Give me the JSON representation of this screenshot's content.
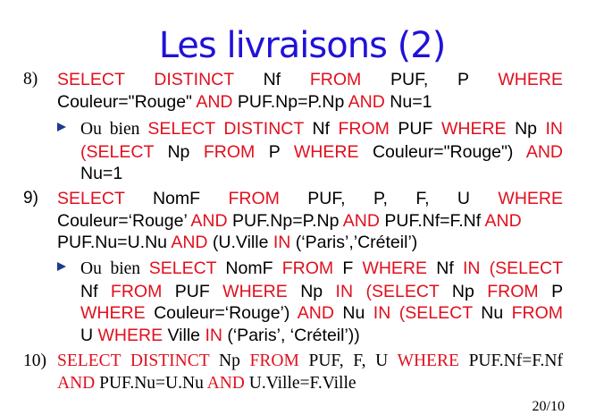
{
  "title": "Les livraisons (2)",
  "q8": {
    "num": "8)",
    "l1": [
      [
        "SELECT",
        "k"
      ],
      [
        "DISTINCT",
        "k"
      ],
      [
        "Nf",
        "t"
      ],
      [
        "FROM",
        "k"
      ],
      [
        "PUF,",
        "t"
      ],
      [
        "P",
        "t"
      ],
      [
        "WHERE",
        "k"
      ]
    ],
    "l2": [
      [
        "Couleur=\"Rouge\" ",
        "t"
      ],
      [
        "AND",
        "k"
      ],
      [
        " PUF.Np=P.Np ",
        "t"
      ],
      [
        "AND",
        "k"
      ],
      [
        " Nu=1",
        "t"
      ]
    ],
    "alt_prefix": "Ou bien ",
    "a1": [
      [
        "SELECT DISTINCT",
        "k"
      ],
      [
        " Nf ",
        "t"
      ],
      [
        "FROM",
        "k"
      ],
      [
        " PUF ",
        "t"
      ],
      [
        "WHERE",
        "k"
      ],
      [
        " Np ",
        "t"
      ],
      [
        "IN",
        "k"
      ]
    ],
    "a2": [
      [
        "(SELECT",
        "k"
      ],
      [
        "Np",
        "t"
      ],
      [
        "FROM",
        "k"
      ],
      [
        "P",
        "t"
      ],
      [
        "WHERE",
        "k"
      ],
      [
        "Couleur=\"Rouge\")",
        "t"
      ],
      [
        "AND",
        "k"
      ]
    ],
    "a3": "Nu=1"
  },
  "q9": {
    "num": "9)",
    "l1": [
      [
        "SELECT",
        "k"
      ],
      [
        "NomF",
        "t"
      ],
      [
        "FROM",
        "k"
      ],
      [
        "PUF,",
        "t"
      ],
      [
        "P,",
        "t"
      ],
      [
        "F,",
        "t"
      ],
      [
        "U",
        "t"
      ],
      [
        "WHERE",
        "k"
      ]
    ],
    "l2": [
      [
        "Couleur=‘Rouge’ ",
        "t"
      ],
      [
        "AND",
        "k"
      ],
      [
        " PUF.Np=P.Np ",
        "t"
      ],
      [
        "AND",
        "k"
      ],
      [
        " PUF.Nf=F.Nf ",
        "t"
      ],
      [
        "AND",
        "k"
      ]
    ],
    "l3": [
      [
        "PUF.Nu=U.Nu ",
        "t"
      ],
      [
        "AND",
        "k"
      ],
      [
        " (U.Ville ",
        "t"
      ],
      [
        "IN",
        "k"
      ],
      [
        " (‘Paris’,’Créteil’)",
        "t"
      ]
    ],
    "alt_prefix": "Ou bien ",
    "a1": [
      [
        "SELECT",
        "k"
      ],
      [
        " NomF ",
        "t"
      ],
      [
        "FROM",
        "k"
      ],
      [
        " F ",
        "t"
      ],
      [
        "WHERE",
        "k"
      ],
      [
        " Nf ",
        "t"
      ],
      [
        "IN",
        "k"
      ],
      [
        " (SELECT",
        "k"
      ]
    ],
    "a2": [
      [
        "Nf",
        "t"
      ],
      [
        "FROM",
        "k"
      ],
      [
        "PUF",
        "t"
      ],
      [
        "WHERE",
        "k"
      ],
      [
        "Np",
        "t"
      ],
      [
        "IN",
        "k"
      ],
      [
        "(SELECT",
        "k"
      ],
      [
        "Np",
        "t"
      ],
      [
        "FROM",
        "k"
      ],
      [
        "P",
        "t"
      ]
    ],
    "a3": [
      [
        "WHERE",
        "k"
      ],
      [
        "Couleur=‘Rouge’)",
        "t"
      ],
      [
        "AND",
        "k"
      ],
      [
        "Nu",
        "t"
      ],
      [
        "IN",
        "k"
      ],
      [
        "(SELECT",
        "k"
      ],
      [
        "Nu",
        "t"
      ],
      [
        "FROM",
        "k"
      ]
    ],
    "a4": [
      [
        "U ",
        "t"
      ],
      [
        "WHERE",
        "k"
      ],
      [
        " Ville ",
        "t"
      ],
      [
        "IN",
        "k"
      ],
      [
        " (‘Paris’, ‘Créteil’))",
        "t"
      ]
    ]
  },
  "q10": {
    "num": "10)",
    "l1": [
      [
        "SELECT DISTINCT",
        "k"
      ],
      [
        " Np ",
        "t"
      ],
      [
        "FROM",
        "k"
      ],
      [
        " PUF, F, U ",
        "t"
      ],
      [
        "WHERE",
        "k"
      ],
      [
        " PUF.Nf=F.Nf",
        "t"
      ]
    ],
    "l2": [
      [
        "AND",
        "k"
      ],
      [
        " PUF.Nu=U.Nu ",
        "t"
      ],
      [
        "AND",
        "k"
      ],
      [
        " U.Ville=F.Ville",
        "t"
      ]
    ]
  },
  "page_number": "20/10"
}
